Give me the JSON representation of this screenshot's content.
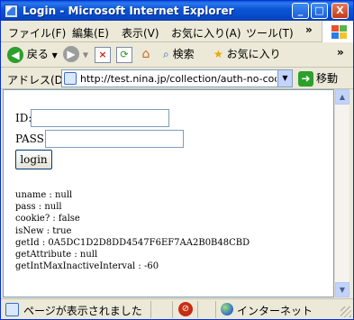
{
  "window": {
    "title": "Login - Microsoft Internet Explorer",
    "controls": {
      "minimize": "_",
      "maximize": "□",
      "close": "X"
    }
  },
  "menu": {
    "items": [
      "ファイル(F)",
      "編集(E)",
      "表示(V)",
      "お気に入り(A)",
      "ツール(T)"
    ],
    "overflow": "»"
  },
  "toolbar": {
    "back_label": "戻る",
    "search_label": "検索",
    "favorites_label": "お気に入り",
    "overflow": "»"
  },
  "address": {
    "label": "アドレス(D)",
    "url": "http://test.nina.jp/collection/auth-no-cook",
    "go_label": "移動"
  },
  "form": {
    "id_label": "ID:",
    "id_value": "",
    "pass_label": "PASS:",
    "pass_value": "",
    "login_label": "login"
  },
  "info": {
    "lines": [
      "uname : null",
      "pass : null",
      "cookie? : false",
      "isNew : true",
      "getId : 0A5DC1D2D8DD4547F6EF7AA2B0B48CBD",
      "getAttribute : null",
      "getIntMaxInactiveInterval : -60"
    ]
  },
  "status": {
    "text": "ページが表示されました",
    "zone": "インターネット"
  },
  "icons": {
    "app": "ie-page-icon",
    "back": "back-arrow-icon",
    "forward": "forward-arrow-icon",
    "stop": "stop-icon",
    "refresh": "refresh-icon",
    "home": "home-icon",
    "search": "search-icon",
    "favorites": "favorites-star-icon",
    "go": "go-arrow-icon",
    "zone": "internet-globe-icon"
  },
  "colors": {
    "titlebar": "#0a56d6",
    "chrome": "#ece9d8",
    "back_green": "#2c9f2c",
    "address_border": "#7f9db9"
  }
}
